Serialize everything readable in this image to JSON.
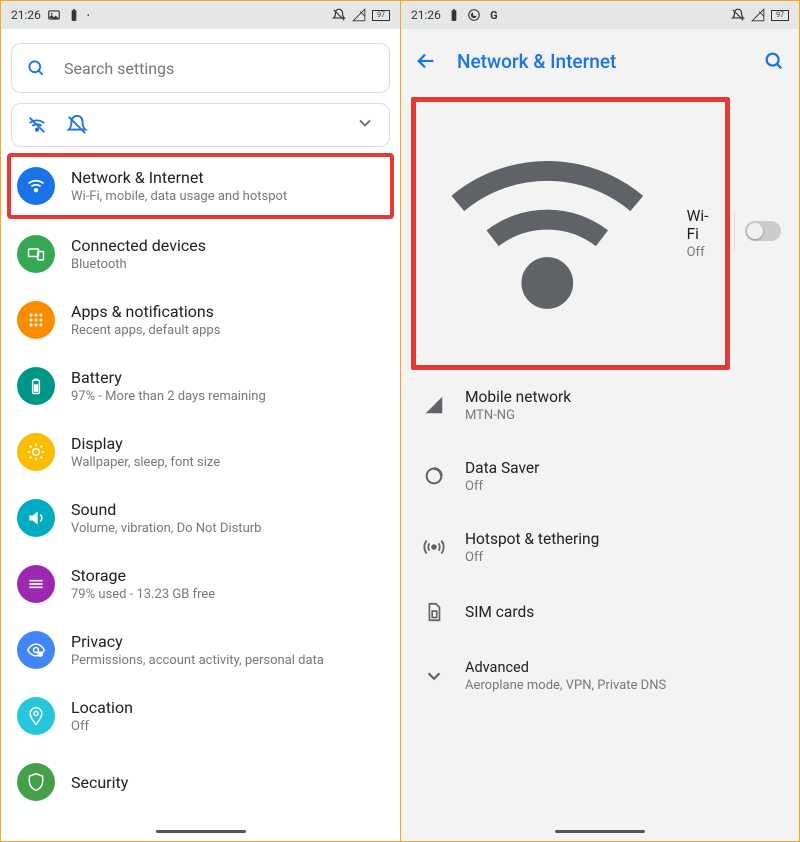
{
  "left": {
    "status": {
      "time": "21:26",
      "battery": "97"
    },
    "search": {
      "placeholder": "Search settings"
    },
    "items": [
      {
        "title": "Network & Internet",
        "sub": "Wi-Fi, mobile, data usage and hotspot"
      },
      {
        "title": "Connected devices",
        "sub": "Bluetooth"
      },
      {
        "title": "Apps & notifications",
        "sub": "Recent apps, default apps"
      },
      {
        "title": "Battery",
        "sub": "97% - More than 2 days remaining"
      },
      {
        "title": "Display",
        "sub": "Wallpaper, sleep, font size"
      },
      {
        "title": "Sound",
        "sub": "Volume, vibration, Do Not Disturb"
      },
      {
        "title": "Storage",
        "sub": "79% used - 13.23 GB free"
      },
      {
        "title": "Privacy",
        "sub": "Permissions, account activity, personal data"
      },
      {
        "title": "Location",
        "sub": "Off"
      },
      {
        "title": "Security",
        "sub": ""
      }
    ]
  },
  "right": {
    "status": {
      "time": "21:26",
      "battery": "97"
    },
    "title": "Network & Internet",
    "items": [
      {
        "title": "Wi-Fi",
        "sub": "Off"
      },
      {
        "title": "Mobile network",
        "sub": "MTN-NG"
      },
      {
        "title": "Data Saver",
        "sub": "Off"
      },
      {
        "title": "Hotspot & tethering",
        "sub": "Off"
      },
      {
        "title": "SIM cards",
        "sub": ""
      },
      {
        "title": "Advanced",
        "sub": "Aeroplane mode, VPN, Private DNS"
      }
    ]
  }
}
